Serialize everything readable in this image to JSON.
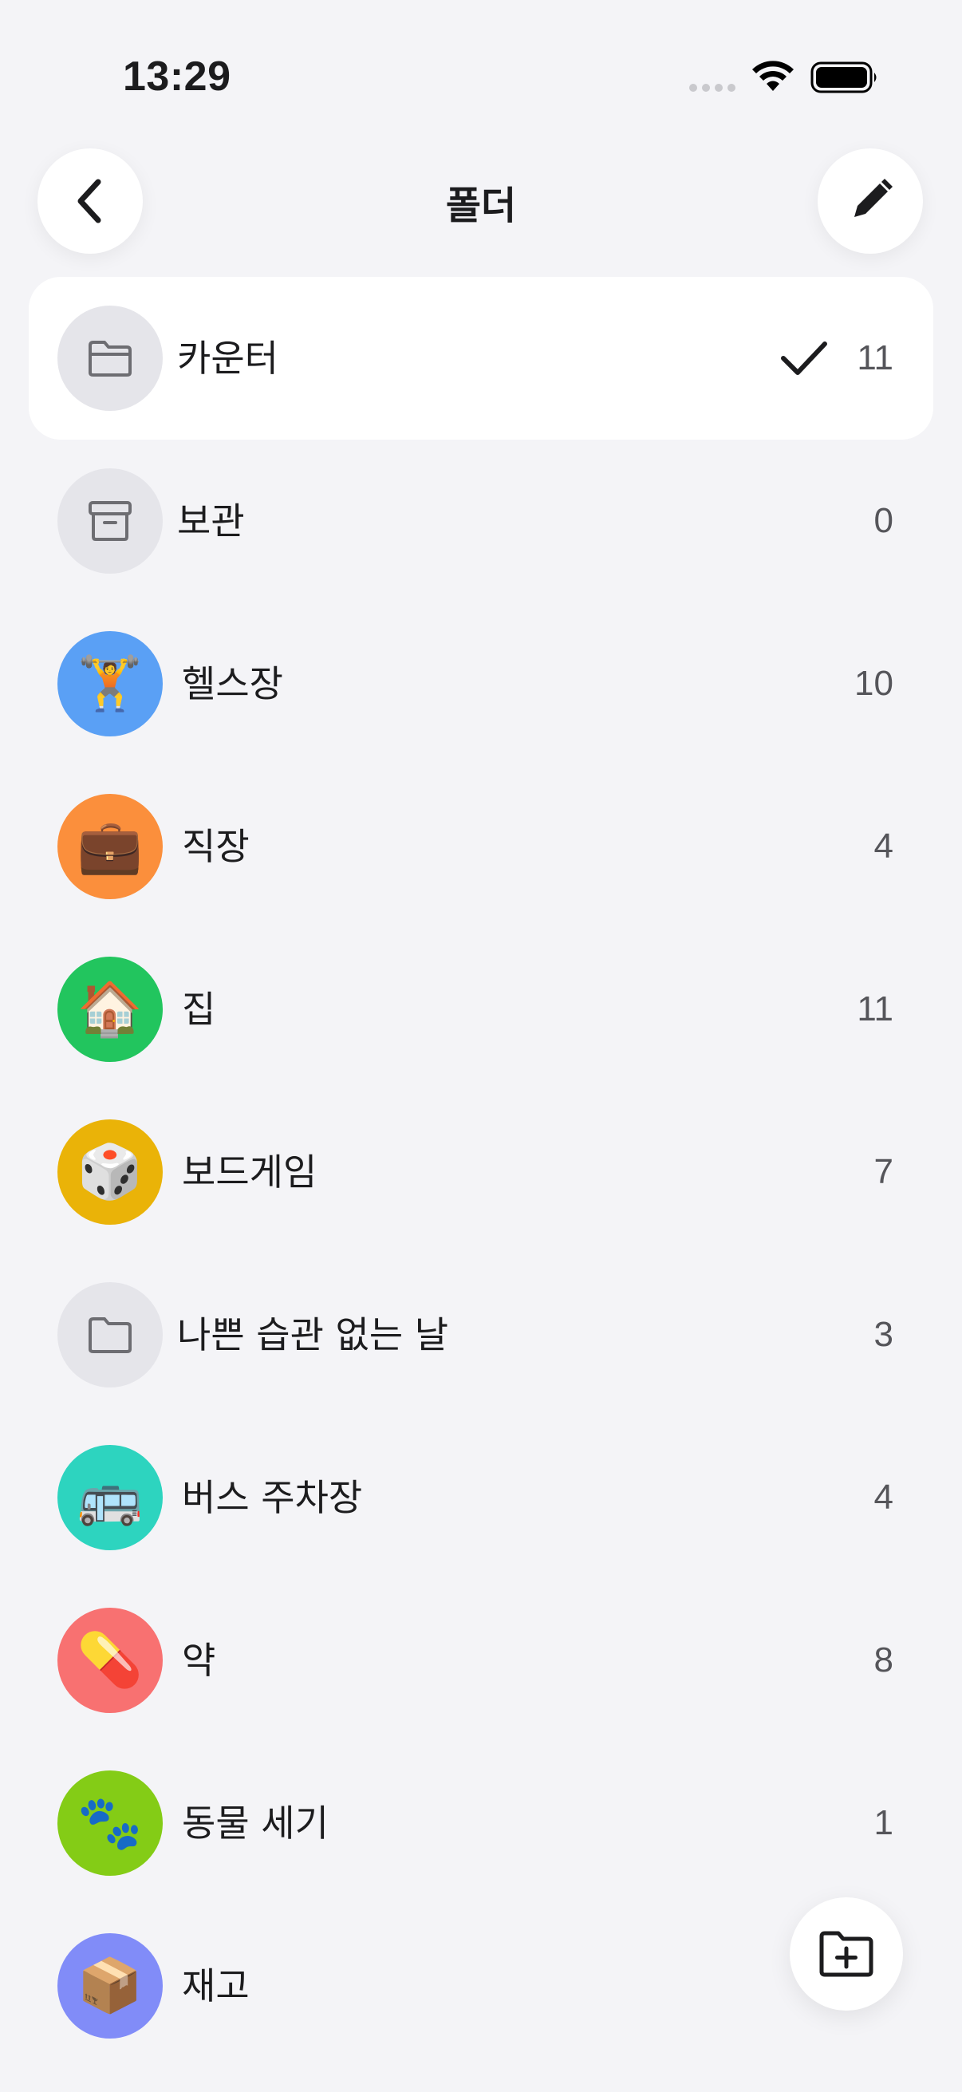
{
  "status_bar": {
    "time": "13:29"
  },
  "nav": {
    "title": "폴더"
  },
  "folders": [
    {
      "name": "카운터",
      "count": "11",
      "icon": "folder-icon",
      "color": "#e5e5ea",
      "selected": true
    },
    {
      "name": "보관",
      "count": "0",
      "icon": "archive-box-icon",
      "color": "#e5e5ea"
    },
    {
      "name": "헬스장",
      "count": "10",
      "icon": "weightlifter-emoji",
      "emoji": "🏋️",
      "color": "#5aa0f5"
    },
    {
      "name": "직장",
      "count": "4",
      "icon": "briefcase-emoji",
      "emoji": "💼",
      "color": "#fb8f3c"
    },
    {
      "name": "집",
      "count": "11",
      "icon": "house-emoji",
      "emoji": "🏠",
      "color": "#22c55e"
    },
    {
      "name": "보드게임",
      "count": "7",
      "icon": "dice-emoji",
      "emoji": "🎲",
      "color": "#eab308"
    },
    {
      "name": "나쁜 습관 없는 날",
      "count": "3",
      "icon": "folder-icon",
      "color": "#e5e5ea"
    },
    {
      "name": "버스 주차장",
      "count": "4",
      "icon": "bus-emoji",
      "emoji": "🚌",
      "color": "#2dd4bf"
    },
    {
      "name": "약",
      "count": "8",
      "icon": "pill-emoji",
      "emoji": "💊",
      "color": "#f87171"
    },
    {
      "name": "동물 세기",
      "count": "1",
      "icon": "paw-prints-emoji",
      "emoji": "🐾",
      "color": "#84cc16"
    },
    {
      "name": "재고",
      "count": "",
      "icon": "package-emoji",
      "emoji": "📦",
      "color": "#818cf8"
    }
  ],
  "icons": {
    "back": "chevron-left-icon",
    "edit": "pencil-icon",
    "check": "checkmark-icon",
    "add_folder": "folder-plus-icon"
  }
}
